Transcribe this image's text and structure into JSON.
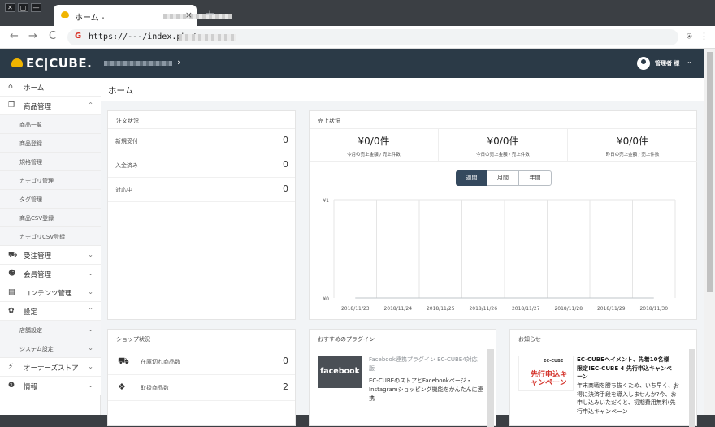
{
  "browser": {
    "window_buttons": [
      "✕",
      "▢",
      "—"
    ],
    "tab_title": "ホーム -",
    "tab_close": "×",
    "new_tab": "+",
    "url": "https://---/index.php/",
    "nav": {
      "back": "←",
      "forward": "→",
      "reload": "C"
    },
    "toolbar_icons": {
      "extension": "⍟",
      "menu": "⋮"
    }
  },
  "header": {
    "logo": "EC|CUBE.",
    "shop_arrow": "›",
    "user": "管理者 様",
    "user_caret": "⌄"
  },
  "sidebar": {
    "items": [
      {
        "icon": "⌂",
        "label": "ホーム",
        "chevron": ""
      },
      {
        "icon": "❒",
        "label": "商品管理",
        "chevron": "⌃"
      }
    ],
    "product_sub": [
      "商品一覧",
      "商品登録",
      "規格管理",
      "カテゴリ管理",
      "タグ管理",
      "商品CSV登録",
      "カテゴリCSV登録"
    ],
    "items2": [
      {
        "icon": "⛟",
        "label": "受注管理",
        "chevron": "⌄"
      },
      {
        "icon": "☻",
        "label": "会員管理",
        "chevron": "⌄"
      },
      {
        "icon": "▤",
        "label": "コンテンツ管理",
        "chevron": "⌄"
      },
      {
        "icon": "✿",
        "label": "設定",
        "chevron": "⌃"
      }
    ],
    "settings_sub": [
      "店舗設定",
      "システム設定"
    ],
    "settings_sub_chev": [
      "⌄",
      "⌄"
    ],
    "items3": [
      {
        "icon": "⚡",
        "label": "オーナーズストア",
        "chevron": "⌄"
      },
      {
        "icon": "❶",
        "label": "情報",
        "chevron": "⌄"
      }
    ]
  },
  "main": {
    "page_title": "ホーム",
    "orders": {
      "title": "注文状況",
      "rows": [
        {
          "label": "新規受付",
          "value": "0"
        },
        {
          "label": "入金済み",
          "value": "0"
        },
        {
          "label": "対応中",
          "value": "0"
        }
      ]
    },
    "sales": {
      "title": "売上状況",
      "cells": [
        {
          "value": "¥0/0件",
          "caption": "今月の売上金額 / 売上件数"
        },
        {
          "value": "¥0/0件",
          "caption": "今日の売上金額 / 売上件数"
        },
        {
          "value": "¥0/0件",
          "caption": "昨日の売上金額 / 売上件数"
        }
      ],
      "tabs": [
        "週間",
        "月間",
        "年間"
      ]
    },
    "shop": {
      "title": "ショップ状況",
      "rows": [
        {
          "icon": "⛟",
          "label": "在庫切れ商品数",
          "value": "0"
        },
        {
          "icon": "❖",
          "label": "取扱商品数",
          "value": "2"
        }
      ]
    },
    "plugins": {
      "title": "おすすめのプラグイン",
      "image_text": "facebook",
      "name": "Facebook連携プラグイン EC-CUBE4対応版",
      "description": "EC-CUBEのストアとFacebookページ・Instagramショッピング機能をかんたんに連携"
    },
    "news": {
      "title": "お知らせ",
      "image_logo": "EC-CUBE",
      "image_badge": "先行申込キャンペーン",
      "headline": "EC-CUBEヘイメント、先着10名様限定!EC-CUBE 4 先行申込キャンペーン",
      "body": "年末商戦を勝ち抜くため、いち早く、お得に決済手段を導入しませんか?今、お申し込みいただくと、初期費用無料(先行申込キャンペーン",
      "arrow": "›"
    }
  },
  "chart_data": {
    "type": "line",
    "x": [
      "2018/11/23",
      "2018/11/24",
      "2018/11/25",
      "2018/11/26",
      "2018/11/27",
      "2018/11/28",
      "2018/11/29",
      "2018/11/30"
    ],
    "series": [
      {
        "values": [
          0,
          0,
          0,
          0,
          0,
          0,
          0,
          0
        ]
      }
    ],
    "y_ticks": [
      "¥1",
      "¥0"
    ],
    "ylim": [
      0,
      1
    ],
    "grid": true
  }
}
